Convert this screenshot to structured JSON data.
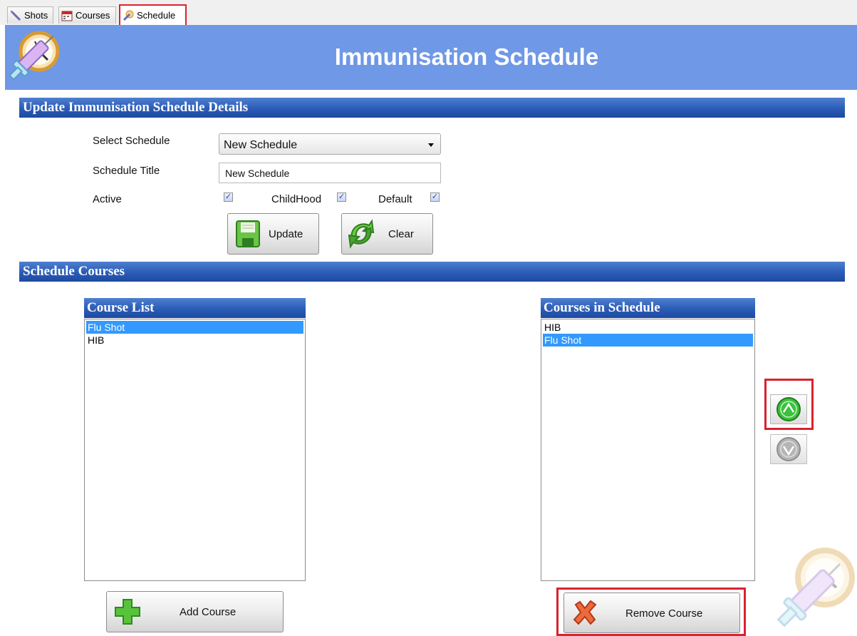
{
  "tabs": [
    {
      "label": "Shots",
      "icon": "syringe-icon"
    },
    {
      "label": "Courses",
      "icon": "calendar-icon"
    },
    {
      "label": "Schedule",
      "icon": "schedule-icon",
      "active": true
    }
  ],
  "header": {
    "title": "Immunisation Schedule",
    "logo": "syringe-clock-logo"
  },
  "details": {
    "section_title": "Update Immunisation Schedule Details",
    "select_label": "Select Schedule",
    "select_value": "New Schedule",
    "title_label": "Schedule Title",
    "title_value": "New Schedule",
    "active_label": "Active",
    "active_checked": true,
    "childhood_label": "ChildHood",
    "childhood_checked": true,
    "default_label": "Default",
    "default_checked": true,
    "update_label": "Update",
    "clear_label": "Clear"
  },
  "courses": {
    "section_title": "Schedule Courses",
    "course_list_title": "Course List",
    "course_list_items": [
      "Flu Shot",
      "HIB"
    ],
    "course_list_selected": 0,
    "schedule_list_title": "Courses in Schedule",
    "schedule_list_items": [
      "HIB",
      "Flu Shot"
    ],
    "schedule_list_selected": 1,
    "add_label": "Add Course",
    "remove_label": "Remove Course",
    "move_up_icon": "move-up-icon",
    "move_down_icon": "move-down-icon"
  },
  "colors": {
    "header_bg": "#6f98e6",
    "section_bar": "#2b5cb6",
    "selection": "#3399ff",
    "highlight_box": "#d9232e"
  }
}
